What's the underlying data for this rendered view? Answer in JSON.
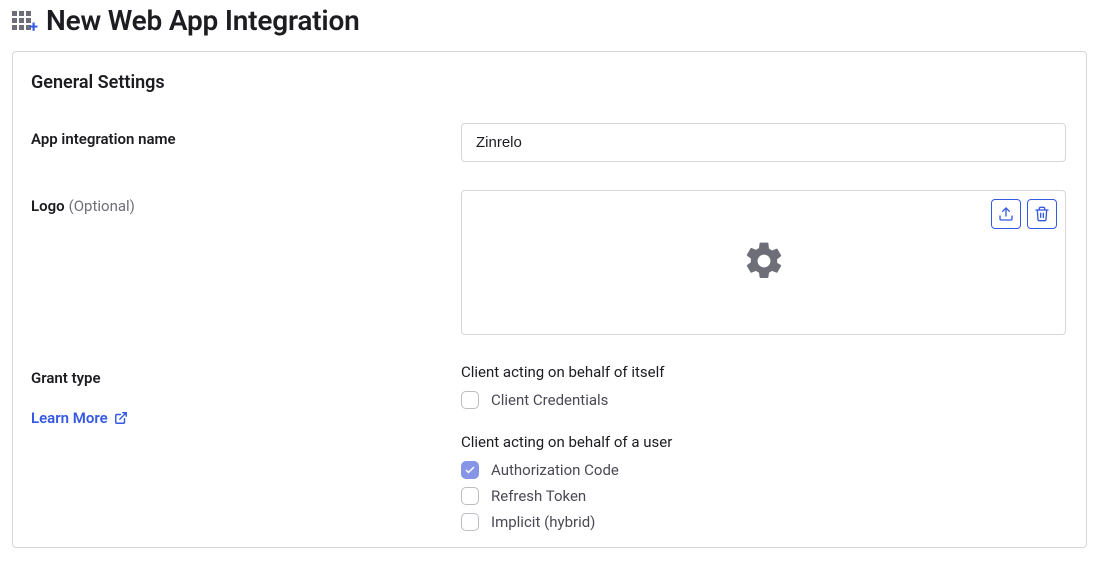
{
  "pageTitle": "New Web App Integration",
  "panel": {
    "sectionTitle": "General Settings",
    "appName": {
      "label": "App integration name",
      "value": "Zinrelo"
    },
    "logo": {
      "label": "Logo",
      "optionalText": "(Optional)"
    },
    "grantType": {
      "label": "Grant type",
      "learnMore": "Learn More",
      "groupSelf": "Client acting on behalf of itself",
      "groupUser": "Client acting on behalf of a user",
      "options": {
        "clientCredentials": {
          "label": "Client Credentials",
          "checked": false
        },
        "authorizationCode": {
          "label": "Authorization Code",
          "checked": true
        },
        "refreshToken": {
          "label": "Refresh Token",
          "checked": false
        },
        "implicit": {
          "label": "Implicit (hybrid)",
          "checked": false
        }
      }
    }
  }
}
